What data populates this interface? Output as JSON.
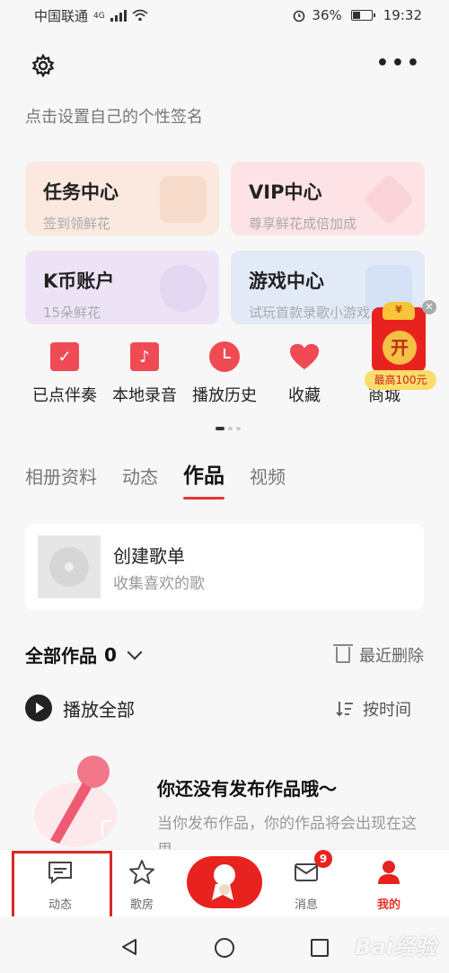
{
  "status_bar": {
    "carrier": "中国联通",
    "network": "4G",
    "battery": "36%",
    "time": "19:32"
  },
  "profile": {
    "signature_prompt": "点击设置自己的个性签名"
  },
  "cards": [
    {
      "title": "任务中心",
      "subtitle": "签到领鲜花"
    },
    {
      "title": "VIP中心",
      "subtitle": "尊享鲜花成倍加成"
    },
    {
      "title": "K币账户",
      "subtitle": "15朵鲜花"
    },
    {
      "title": "游戏中心",
      "subtitle": "试玩首款录歌小游戏"
    }
  ],
  "quick_actions": [
    {
      "label": "已点伴奏",
      "icon": "check-square-icon"
    },
    {
      "label": "本地录音",
      "icon": "music-note-icon"
    },
    {
      "label": "播放历史",
      "icon": "clock-icon"
    },
    {
      "label": "收藏",
      "icon": "heart-icon"
    },
    {
      "label": "商城",
      "icon": "shop-icon"
    }
  ],
  "red_packet": {
    "open": "开",
    "coin": "¥",
    "tag": "最高100元"
  },
  "tabs": [
    {
      "label": "相册资料",
      "active": false
    },
    {
      "label": "动态",
      "active": false
    },
    {
      "label": "作品",
      "active": true
    },
    {
      "label": "视频",
      "active": false
    }
  ],
  "playlist": {
    "title": "创建歌单",
    "subtitle": "收集喜欢的歌"
  },
  "works": {
    "label": "全部作品",
    "count": "0",
    "recent_delete": "最近删除",
    "play_all": "播放全部",
    "sort": "按时间"
  },
  "empty": {
    "title": "你还没有发布作品哦～",
    "subtitle": "当你发布作品，你的作品将会出现在这里"
  },
  "bottom_nav": {
    "feed": "动态",
    "rooms": "歌房",
    "messages": "消息",
    "messages_badge": "9",
    "me": "我的"
  },
  "colors": {
    "accent": "#e8332e",
    "highlight_box": "#d82a25"
  },
  "watermark": "Bai经验"
}
